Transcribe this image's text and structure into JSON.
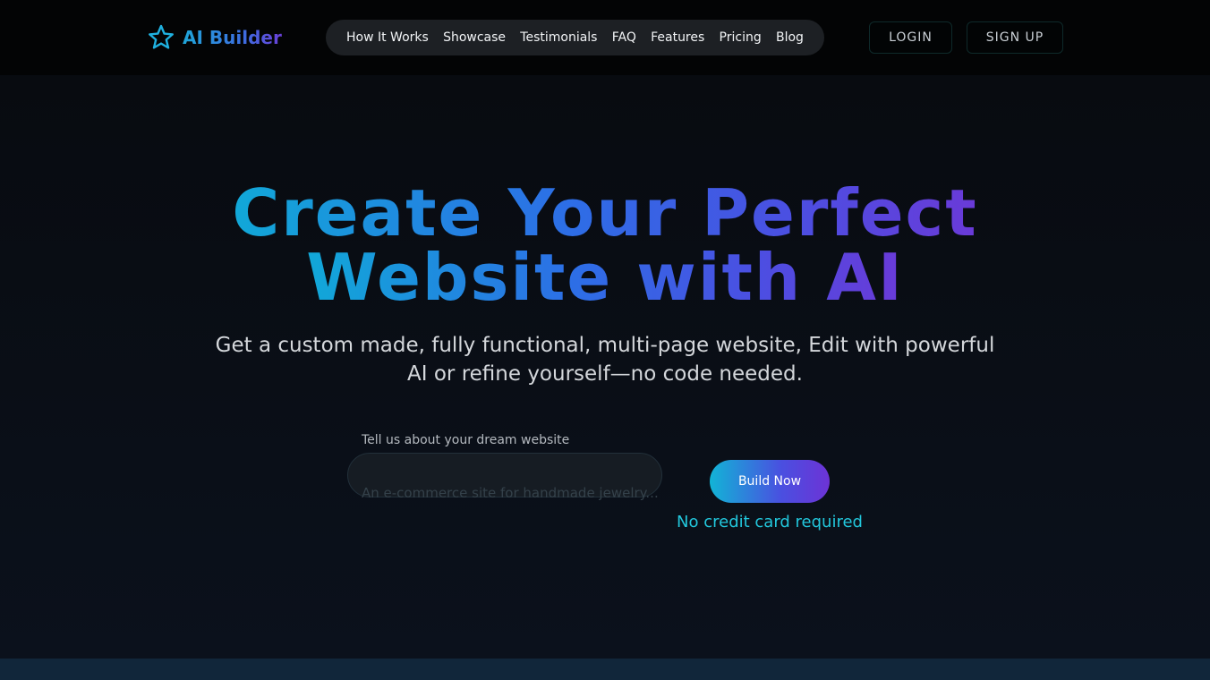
{
  "brand": {
    "name": "AI Builder",
    "icon": "star-icon",
    "icon_color": "#1fb1e0"
  },
  "nav": {
    "items": [
      {
        "label": "How It Works"
      },
      {
        "label": "Showcase"
      },
      {
        "label": "Testimonials"
      },
      {
        "label": "FAQ"
      },
      {
        "label": "Features"
      },
      {
        "label": "Pricing"
      },
      {
        "label": "Blog"
      }
    ]
  },
  "auth": {
    "login_label": "LOGIN",
    "signup_label": "SIGN UP"
  },
  "hero": {
    "headline_line1": "Create Your Perfect",
    "headline_line2": "Website with AI",
    "subhead": "Get a custom made, fully functional, multi-page website, Edit with powerful AI or refine yourself—no code needed.",
    "input_label": "Tell us about your dream website",
    "input_value": "",
    "input_placeholder": "An e-commerce site for handmade jewelry...",
    "cta_label": "Build Now",
    "cta_note": "No credit card required"
  },
  "colors": {
    "background": "#0b0f16",
    "topbar": "#030405",
    "accent_cyan": "#22c7dc",
    "accent_blue": "#2d6ee6",
    "accent_purple": "#6a3ad8",
    "nav_pill": "#1d2024"
  }
}
